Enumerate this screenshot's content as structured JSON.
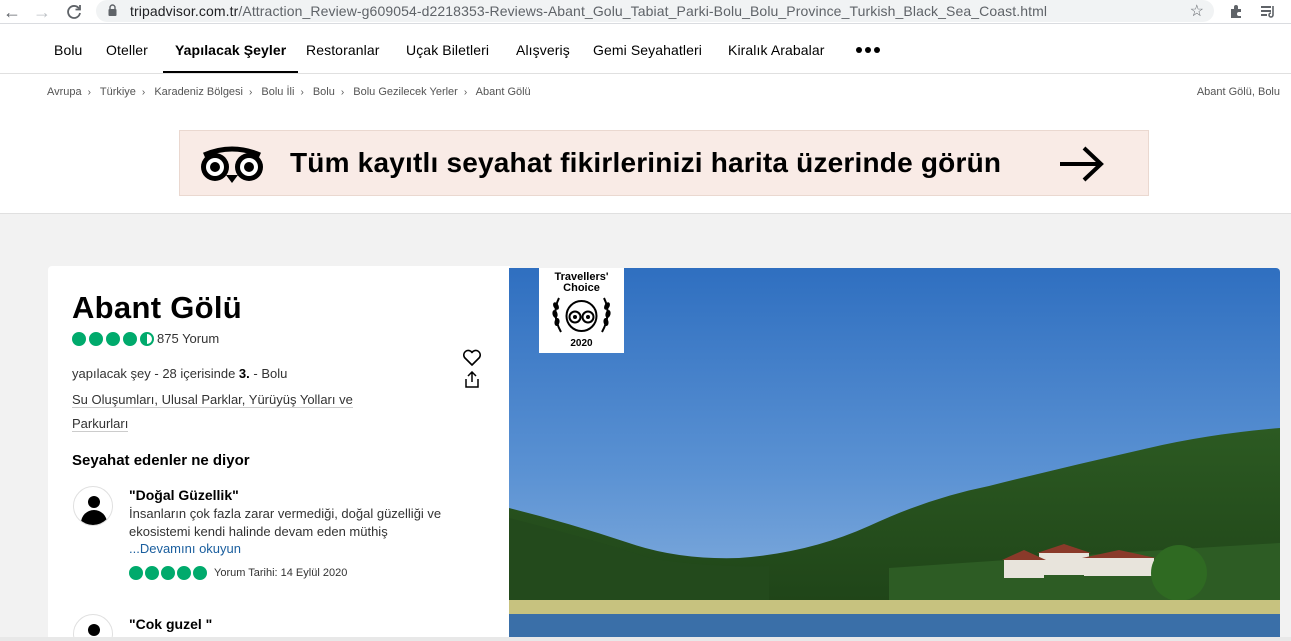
{
  "browser": {
    "url_domain": "tripadvisor.com.tr",
    "url_path": "/Attraction_Review-g609054-d2218353-Reviews-Abant_Golu_Tabiat_Parki-Bolu_Bolu_Province_Turkish_Black_Sea_Coast.html",
    "back_icon": "arrow-left",
    "forward_icon": "arrow-right",
    "reload_icon": "reload",
    "star_icon": "bookmark-star"
  },
  "nav": {
    "items": [
      "Bolu",
      "Oteller",
      "Yapılacak Şeyler",
      "Restoranlar",
      "Uçak Biletleri",
      "Alışveriş",
      "Gemi Seyahatleri",
      "Kiralık Arabalar"
    ],
    "active_index": 2,
    "more_icon": "more-dots"
  },
  "breadcrumb": {
    "items": [
      "Avrupa",
      "Türkiye",
      "Karadeniz Bölgesi",
      "Bolu İli",
      "Bolu",
      "Bolu Gezilecek Yerler",
      "Abant Gölü"
    ],
    "location_right": "Abant Gölü, Bolu"
  },
  "banner": {
    "text": "Tüm kayıtlı seyahat fikirlerinizi harita üzerinde görün"
  },
  "attraction": {
    "title": "Abant Gölü",
    "rating": 4.5,
    "review_count": "875 Yorum",
    "rank_prefix": "yapılacak şey - 28 içerisinde ",
    "rank_number": "3.",
    "rank_suffix": " - Bolu",
    "categories": "Su Oluşumları, Ulusal Parklar, Yürüyüş Yolları ve Parkurları"
  },
  "reviews_section": {
    "heading": "Seyahat edenler ne diyor",
    "reviews": [
      {
        "title": "\"Doğal Güzellik\"",
        "text": "İnsanların çok fazla zarar vermediği, doğal güzelliği ve ekosistemi kendi halinde devam eden müthiş",
        "read_more": "...Devamını okuyun",
        "rating": 5,
        "date": "Yorum Tarihi: 14 Eylül 2020"
      },
      {
        "title": "\"Cok guzel \""
      }
    ]
  },
  "badge": {
    "line1": "Travellers'",
    "line2": "Choice",
    "year": "2020"
  },
  "colors": {
    "accent_green": "#00aa6c",
    "link_blue": "#1a5e9e",
    "banner_bg": "#f9ebe6"
  }
}
